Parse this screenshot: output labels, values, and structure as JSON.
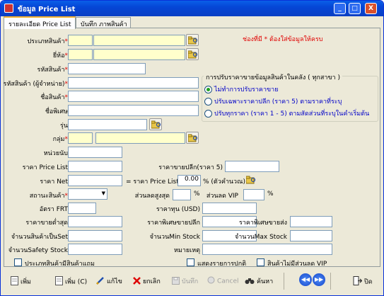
{
  "window": {
    "title": "ข้อมูล Price List",
    "minimize": "_",
    "maximize": "□",
    "close": "X"
  },
  "tabs": [
    {
      "label": "รายละเอียด Price List"
    },
    {
      "label": "บันทึก ภาพสินค้า"
    }
  ],
  "note": "ช่องที่มี * ต้องใส่ข้อมูลให้ครบ",
  "form": {
    "product_type": {
      "label": "ประเภทสินค้า",
      "code": "",
      "name": ""
    },
    "brand": {
      "label": "ยี่ห้อ",
      "code": "",
      "name": ""
    },
    "product_code": {
      "label": "รหัสสินค้า",
      "value": ""
    },
    "vendor_product_code": {
      "label": "รหัสสินค้า (ผู้จำหน่าย)",
      "value": ""
    },
    "product_name": {
      "label": "ชื่อสินค้า",
      "value": ""
    },
    "extra_name": {
      "label": "ชื่อพิเศษ",
      "value": ""
    },
    "model": {
      "label": "รุ่น",
      "value": ""
    },
    "group": {
      "label": "กลุ่ม",
      "code": "",
      "name": ""
    },
    "unit": {
      "label": "หน่วยนับ",
      "value": ""
    },
    "price_list": {
      "label": "ราคา Price List",
      "value": ""
    },
    "retail_price5": {
      "label": "ราคาขายปลีก(ราคา 5)",
      "value": ""
    },
    "net_price": {
      "label": "ราคา Net",
      "value": ""
    },
    "formula": {
      "label": "= ราคา Price List -",
      "value": "0.00",
      "suffix": "% (ตัวคำนวณ)"
    },
    "product_status": {
      "label": "สถานะสินค้า",
      "value": ""
    },
    "max_discount": {
      "label": "ส่วนลดสูงสุด",
      "value": "",
      "unit": "%"
    },
    "vip_discount": {
      "label": "ส่วนลด VIP",
      "value": "",
      "unit": "%"
    },
    "frt_rate": {
      "label": "อัตรา FRT",
      "value": ""
    },
    "cost_usd": {
      "label": "ราคาทุน (USD)",
      "value": ""
    },
    "min_sale_price": {
      "label": "ราคาขายต่ำสุด",
      "value": ""
    },
    "special_retail_price": {
      "label": "ราคาพิเศษขายปลีก",
      "value": ""
    },
    "special_wholesale_price": {
      "label": "ราคาพิเศษขายส่ง",
      "value": ""
    },
    "qty_per_set": {
      "label": "จำนวนสินค้าเป็นSet",
      "value": ""
    },
    "min_stock": {
      "label": "จำนวนMin Stock",
      "value": ""
    },
    "max_stock": {
      "label": "จำนวนMax Stock",
      "value": ""
    },
    "safety_stock": {
      "label": "จำนวนSafety Stock",
      "value": ""
    },
    "remark": {
      "label": "หมายเหตุ",
      "value": ""
    }
  },
  "price_adjust": {
    "title": "การปรับราคาขายข้อมูลสินค้าในคลัง ( ทุกสาขา )",
    "options": [
      {
        "label": "ไม่ทำการปรับราคาขาย",
        "selected": true
      },
      {
        "label": "ปรับเฉพาะราคาปลีก (ราคา 5) ตามราคาที่ระบุ",
        "selected": false
      },
      {
        "label": "ปรับทุกราคา (ราคา 1 - 5) ตามสัดส่วนที่ระบุในคำเริ่มต้น",
        "selected": false
      }
    ]
  },
  "checkboxes": {
    "has_type_stock": "ประเภทสินค้ามีสินค้าแถม",
    "show_normal": "แสดงรายการปกติ",
    "no_vip_discount": "สินค้าไม่มีส่วนลด VIP"
  },
  "toolbar": {
    "add": "เพิ่ม",
    "copy_add": "เพิ่ม (C)",
    "edit": "แก้ไข",
    "cancel_edit": "ยกเลิก",
    "save": "บันทึก",
    "cancel": "Cancel",
    "search": "ค้นหา",
    "exit": "ปิด"
  }
}
